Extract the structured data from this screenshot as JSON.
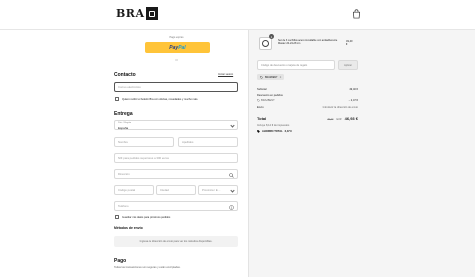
{
  "header": {
    "logo_text": "BRA"
  },
  "express": {
    "label": "Pago exprés",
    "paypal_pay": "Pay",
    "paypal_pal": "Pal",
    "or_label": "O"
  },
  "contact": {
    "title": "Contacto",
    "login_link": "Iniciar sesión",
    "email_placeholder": "Correo electrónico",
    "news_checkbox": "Quiero recibir el boletín Bra con ofertas, novedades y mucho más."
  },
  "delivery": {
    "title": "Entrega",
    "country_label": "País / Región",
    "country_value": "España",
    "first_name": "Nombre",
    "last_name": "Apellidos",
    "nif": "NIF para pedidos superiores a 300 euros",
    "address": "Dirección",
    "postal": "Código postal",
    "city": "Ciudad",
    "province": "Provincia / E…",
    "phone": "Teléfono",
    "save_checkbox": "Guardar mis datos para próximos pedidos"
  },
  "shipping": {
    "title": "Métodos de envío",
    "placeholder": "Ingresa tu dirección de envío para ver los métodos disponibles."
  },
  "payment": {
    "title": "Pago",
    "subtitle": "Todas las transacciones son seguras y están encriptadas."
  },
  "order": {
    "product_qty": "1",
    "product_name": "Set de 3 cuchillos acero inoxidable con antiadherente Master 20-24-28 cm",
    "product_price": "49,40 €",
    "discount_placeholder": "Código de descuento o tarjeta de regalo",
    "apply_label": "Aplicar",
    "applied_code": "BRA2BENT",
    "subtotal_label": "Subtotal",
    "subtotal_value": "49,40 €",
    "order_discount_label": "Descuento en pedidos",
    "order_discount_code": "BRA2BENT",
    "order_discount_value": "− 2,47 €",
    "shipping_label": "Envío",
    "shipping_value": "Introducir la dirección de envío",
    "total_label": "Total",
    "total_currency": "EUR",
    "total_old": "49,40",
    "total_value": "46,93 €",
    "tax_note": "Incluye 8,14 € de impuestos",
    "savings_label": "AHORRO TOTAL",
    "savings_value": "2,47 €"
  }
}
